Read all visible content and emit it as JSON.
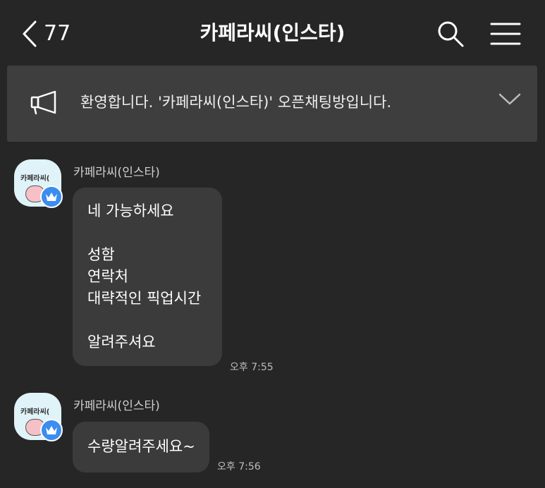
{
  "header": {
    "back_count": "77",
    "title": "카페라씨(인스타)"
  },
  "notice": {
    "text": "환영합니다. '카페라씨(인스타)' 오픈채팅방입니다."
  },
  "messages": [
    {
      "sender": "카페라씨(인스타)",
      "avatar_text": "카페라씨(",
      "lines": [
        "네 가능하세요",
        "",
        "성함",
        "연락처",
        "대략적인 픽업시간",
        "",
        "알려주셔요"
      ],
      "time": "오후 7:55"
    },
    {
      "sender": "카페라씨(인스타)",
      "avatar_text": "카페라씨(",
      "lines": [
        "수량알려주세요~"
      ],
      "time": "오후 7:56"
    }
  ],
  "colors": {
    "background": "#262626",
    "notice_bg": "#3e3e3e",
    "bubble_bg": "#3b3b3b",
    "badge": "#3b8df0"
  },
  "icons": {
    "back": "chevron-left-icon",
    "search": "search-icon",
    "menu": "hamburger-menu-icon",
    "notice": "megaphone-icon",
    "expand": "chevron-down-icon",
    "badge": "crown-icon"
  }
}
